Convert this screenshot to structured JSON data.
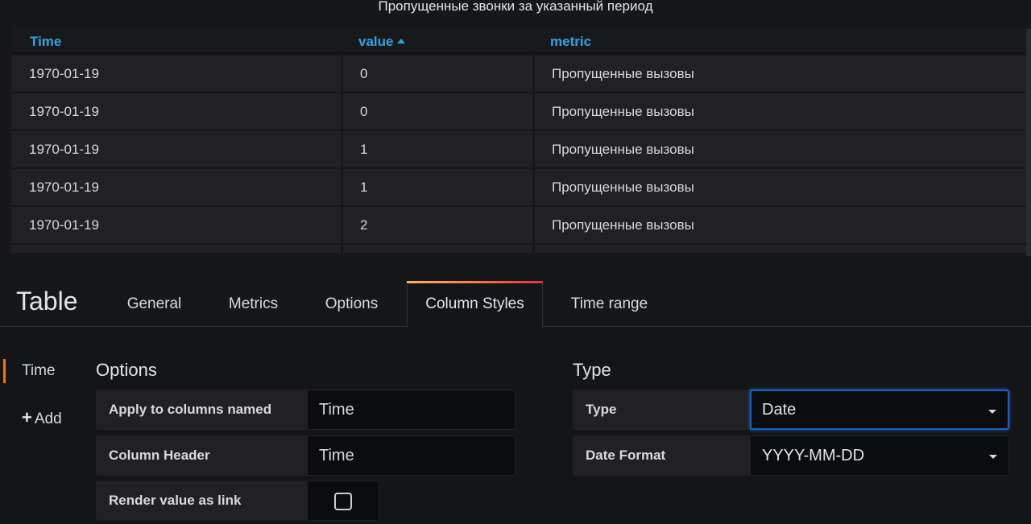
{
  "panel": {
    "title": "Пропущенные звонки за указанный период",
    "columns": [
      "Time",
      "value",
      "metric"
    ],
    "sorted_column": "value",
    "sort_direction": "ascending",
    "rows": [
      [
        "1970-01-19",
        "0",
        "Пропущенные вызовы"
      ],
      [
        "1970-01-19",
        "0",
        "Пропущенные вызовы"
      ],
      [
        "1970-01-19",
        "1",
        "Пропущенные вызовы"
      ],
      [
        "1970-01-19",
        "1",
        "Пропущенные вызовы"
      ],
      [
        "1970-01-19",
        "2",
        "Пропущенные вызовы"
      ]
    ]
  },
  "editor": {
    "title": "Table",
    "tabs": [
      {
        "label": "General",
        "active": false
      },
      {
        "label": "Metrics",
        "active": false
      },
      {
        "label": "Options",
        "active": false
      },
      {
        "label": "Column Styles",
        "active": true
      },
      {
        "label": "Time range",
        "active": false
      }
    ]
  },
  "sidebar": {
    "items": [
      {
        "label": "Time",
        "active": true
      },
      {
        "label": "Add",
        "icon": "plus-icon"
      }
    ]
  },
  "options": {
    "title": "Options",
    "apply_label": "Apply to columns named",
    "apply_value": "Time",
    "header_label": "Column Header",
    "header_value": "Time",
    "link_label": "Render value as link",
    "link_checked": false
  },
  "type_section": {
    "title": "Type",
    "type_label": "Type",
    "type_value": "Date",
    "date_format_label": "Date Format",
    "date_format_value": "YYYY-MM-DD"
  },
  "colors": {
    "accent_blue": "#33a2e5",
    "tab_gradient": [
      "#ffb357",
      "#ff7941",
      "#e02f44"
    ],
    "sidebar_active": "#eb7b18",
    "focus_border": "#1f60c4"
  }
}
